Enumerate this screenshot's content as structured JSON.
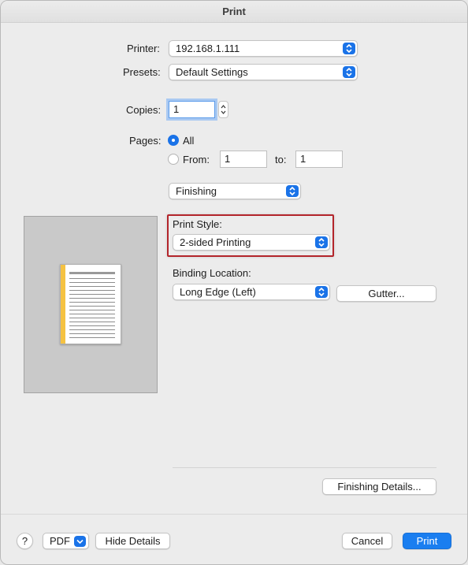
{
  "window": {
    "title": "Print"
  },
  "printer": {
    "label": "Printer:",
    "value": "192.168.1.111"
  },
  "presets": {
    "label": "Presets:",
    "value": "Default Settings"
  },
  "copies": {
    "label": "Copies:",
    "value": "1"
  },
  "pages": {
    "label": "Pages:",
    "all_label": "All",
    "from_label": "From:",
    "from_value": "1",
    "to_label": "to:",
    "to_value": "1",
    "selected": "all"
  },
  "section_popup": {
    "value": "Finishing"
  },
  "print_style": {
    "label": "Print Style:",
    "value": "2-sided Printing"
  },
  "binding": {
    "label": "Binding Location:",
    "value": "Long Edge (Left)",
    "gutter_button": "Gutter..."
  },
  "finishing_details_button": "Finishing Details...",
  "footer": {
    "help": "?",
    "pdf": "PDF",
    "hide_details": "Hide Details",
    "cancel": "Cancel",
    "print": "Print"
  },
  "colors": {
    "accent": "#1a73e8",
    "highlight_border": "#b3252b",
    "gutter": "#f5c242"
  },
  "icons": [
    "updown-chevron-icon",
    "help-icon",
    "chevron-down-icon",
    "stepper-arrows-icon"
  ]
}
